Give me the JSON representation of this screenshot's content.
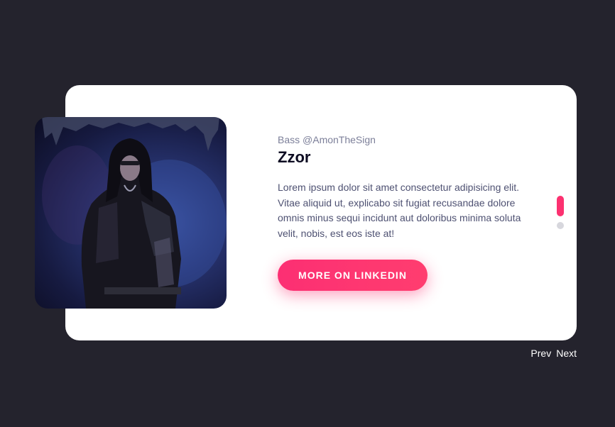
{
  "profile": {
    "subtitle": "Bass @AmonTheSign",
    "name": "Zzor",
    "description": "Lorem ipsum dolor sit amet consectetur adipisicing elit. Vitae aliquid ut, explicabo sit fugiat recusandae dolore omnis minus sequi incidunt aut doloribus minima soluta velit, nobis, est eos iste at!",
    "cta_label": "MORE ON LINKEDIN"
  },
  "pagination": {
    "active_index": 0,
    "count": 2
  },
  "nav": {
    "prev_label": "Prev",
    "next_label": "Next"
  },
  "colors": {
    "background": "#24232d",
    "card": "#ffffff",
    "accent": "#fc2f73",
    "inactive_dot": "#d7d7dd"
  }
}
